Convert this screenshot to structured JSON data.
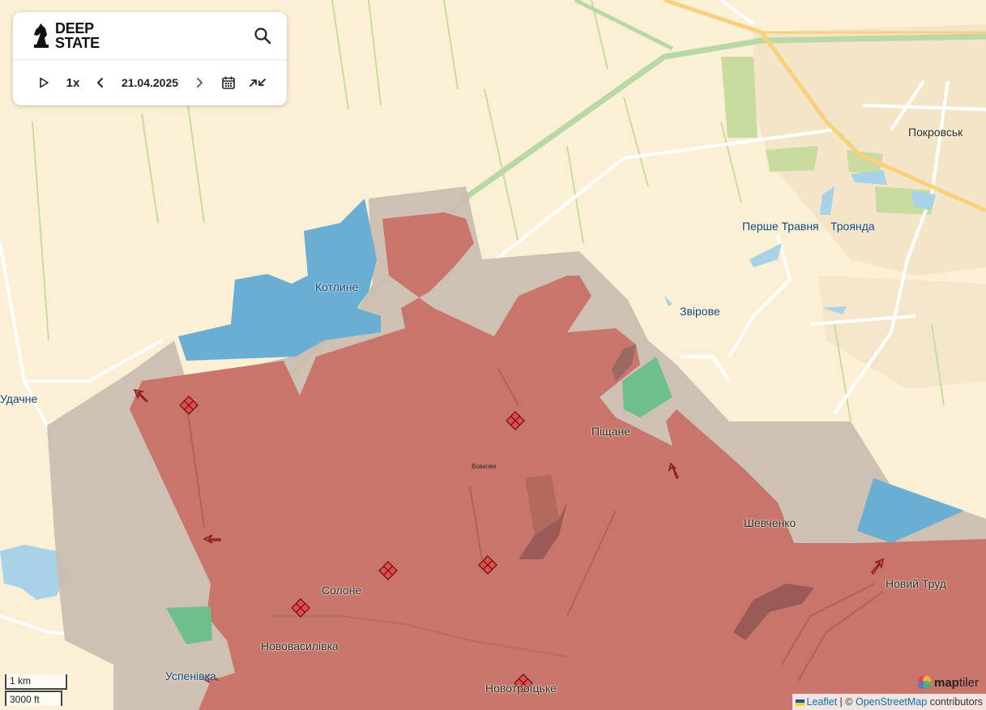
{
  "app": {
    "brand_line1": "DEEP",
    "brand_line2": "STATE"
  },
  "controls": {
    "speed_label": "1x",
    "date": "21.04.2025",
    "icons": [
      "play-icon",
      "chevron-left-icon",
      "chevron-right-icon",
      "calendar-icon",
      "collapse-icon",
      "search-icon"
    ]
  },
  "places": [
    {
      "id": "pokrovsk",
      "label": "Покровськ",
      "style": "normal"
    },
    {
      "id": "pershe-travnia",
      "label": "Перше Травня",
      "style": "blue"
    },
    {
      "id": "troianda",
      "label": "Троянда",
      "style": "blue"
    },
    {
      "id": "kotlyne",
      "label": "Котлине",
      "style": "blue"
    },
    {
      "id": "zvirove",
      "label": "Звірове",
      "style": "blue"
    },
    {
      "id": "udachne",
      "label": "Удачне",
      "style": "blue"
    },
    {
      "id": "pishchane",
      "label": "Піщане",
      "style": "normal"
    },
    {
      "id": "vovkove",
      "label": "Вовкове",
      "style": "small"
    },
    {
      "id": "shevchenko",
      "label": "Шевченко",
      "style": "normal"
    },
    {
      "id": "novyi-trud",
      "label": "Новий Труд",
      "style": "normal"
    },
    {
      "id": "solone",
      "label": "Солоне",
      "style": "normal"
    },
    {
      "id": "novovasylivka",
      "label": "Нововасилівка",
      "style": "normal"
    },
    {
      "id": "uspenivka",
      "label": "Успенівка",
      "style": "blue"
    },
    {
      "id": "novotroitske",
      "label": "Новотроїцьке",
      "style": "normal"
    }
  ],
  "legend_colors": {
    "occupied": "#c8766c",
    "contested": "#c9b9ac",
    "liberated": "#6aaed3",
    "green_area": "#6fbf8a"
  },
  "scale": {
    "metric": "1 km",
    "imperial": "3000 ft"
  },
  "attribution": {
    "leaflet": "Leaflet",
    "separator": " | © ",
    "osm": "OpenStreetMap",
    "suffix": " contributors"
  },
  "maptiler": {
    "bold": "map",
    "light": "tiler"
  }
}
